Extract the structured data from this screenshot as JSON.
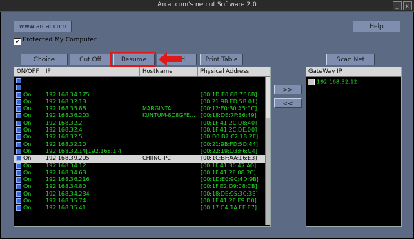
{
  "window": {
    "title": "Arcai.com's netcut Software 2.0",
    "minimize": "_",
    "close": "x"
  },
  "toolbar": {
    "website_button": "www.arcai.com",
    "help_button": "Help",
    "protect_label": "Protected My Computer",
    "protect_checked": "✔",
    "choice_netcard": "Choice NetCard",
    "cut_off": "Cut Off",
    "resume": "Resume",
    "find_partial": "d",
    "print_table": "Print Table",
    "scan_net": "Scan Net",
    "move_right": ">>",
    "move_left": "<<"
  },
  "highlight": {
    "color": "#e01818"
  },
  "host_table": {
    "columns": [
      "ON/OFF",
      "IP",
      "HostName",
      "Physical Address"
    ],
    "rows": [
      {
        "status": "",
        "ip": "",
        "host": "",
        "mac": ""
      },
      {
        "status": "",
        "ip": "",
        "host": "",
        "mac": ""
      },
      {
        "status": "On",
        "ip": "192.168.34.175",
        "host": "",
        "mac": "[00:1D:E0:8B:7F:6B]"
      },
      {
        "status": "On",
        "ip": "192.168.32.13",
        "host": "",
        "mac": "[00:21:9B:FD:5B:01]"
      },
      {
        "status": "On",
        "ip": "192.168.35.88",
        "host": "MARGINTA",
        "mac": "[00:12:F0:30:A5:0C]"
      },
      {
        "status": "On",
        "ip": "192.168.36.203",
        "host": "KUNTUM-8C8GFE...",
        "mac": "[00:18:DE:7F:36:49]"
      },
      {
        "status": "On",
        "ip": "192.168.32.2",
        "host": "",
        "mac": "[00:1F:41:2C:D8:40]"
      },
      {
        "status": "On",
        "ip": "192.168.32.4",
        "host": "",
        "mac": "[00:1F:41:2C:DE:00]"
      },
      {
        "status": "On",
        "ip": "192.168.32.5",
        "host": "",
        "mac": "[00:D0:B7:C2:1B:2E]"
      },
      {
        "status": "On",
        "ip": "192.168.32.10",
        "host": "",
        "mac": "[00:21:9B:FD:5D:44]"
      },
      {
        "status": "On",
        "ip": "192.168.32.14[192.168.1.4",
        "host": "",
        "mac": "[00:22:19:D3:F6:C4]"
      },
      {
        "status": "On",
        "ip": "192.168.39.205",
        "host": "CHIING-PC",
        "mac": "[00:1C:BF:AA:16:E3]",
        "selected": true
      },
      {
        "status": "On",
        "ip": "192.168.34.12",
        "host": "",
        "mac": "[00:1F:41:30:47:A0]"
      },
      {
        "status": "On",
        "ip": "192.168.34.63",
        "host": "",
        "mac": "[00:1F:41:2E:08:20]"
      },
      {
        "status": "On",
        "ip": "192.168.36.216",
        "host": "",
        "mac": "[00:1D:E0:9C:4D:9B]"
      },
      {
        "status": "On",
        "ip": "192.168.34.80",
        "host": "",
        "mac": "[00:1F:E2:D9:08:CB]"
      },
      {
        "status": "On",
        "ip": "192.168.34.234",
        "host": "",
        "mac": "[00:18:DE:95:3C:3B]"
      },
      {
        "status": "On",
        "ip": "192.168.35.74",
        "host": "",
        "mac": "[00:1F:41:2E:E9:D0]"
      },
      {
        "status": "On",
        "ip": "192.168.35.41",
        "host": "",
        "mac": "[00:17:C4:1A:FE:E7]"
      }
    ]
  },
  "gateway": {
    "header": "GateWay IP",
    "entries": [
      "192.168.32.12"
    ]
  }
}
